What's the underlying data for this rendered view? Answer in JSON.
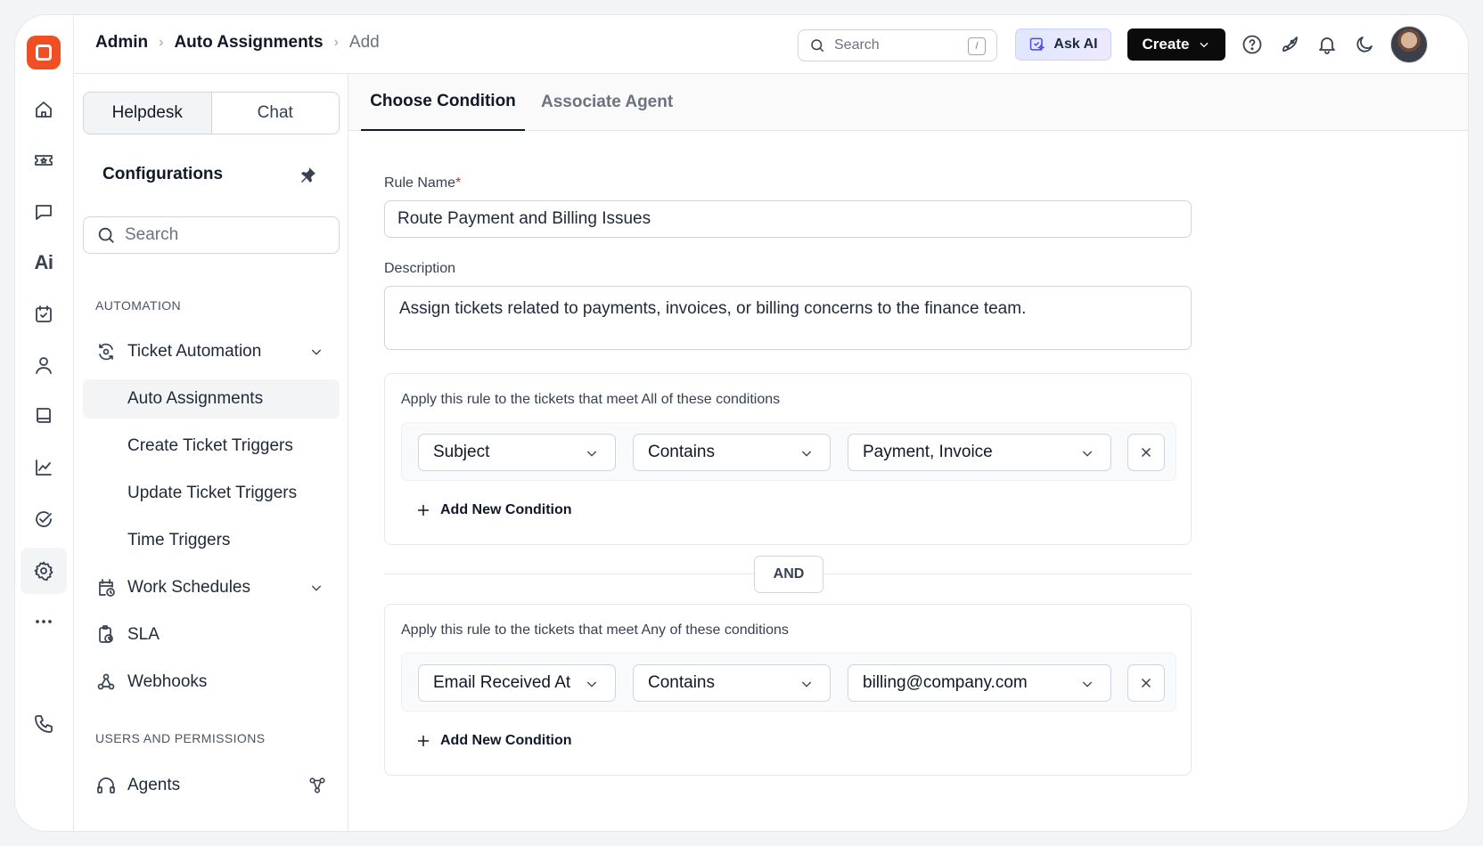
{
  "header": {
    "breadcrumb": [
      "Admin",
      "Auto Assignments",
      "Add"
    ],
    "search_placeholder": "Search",
    "search_shortcut": "/",
    "ask_ai_label": "Ask AI",
    "create_label": "Create"
  },
  "rail": {
    "items": [
      "home-icon",
      "ticket-icon",
      "chat-icon",
      "ai-icon",
      "calendar-check-icon",
      "user-icon",
      "book-icon",
      "chart-icon",
      "check-circle-icon",
      "settings-icon",
      "more-icon",
      "phone-icon"
    ],
    "ai_text": "Ai",
    "active": "settings-icon"
  },
  "config": {
    "segments": [
      "Helpdesk",
      "Chat"
    ],
    "active_segment": "Helpdesk",
    "title": "Configurations",
    "search_placeholder": "Search",
    "section_automation": "AUTOMATION",
    "items": [
      {
        "label": "Ticket Automation",
        "icon": "automation-icon",
        "expandable": true
      },
      {
        "label": "Auto Assignments",
        "active": true
      },
      {
        "label": "Create Ticket Triggers"
      },
      {
        "label": "Update Ticket Triggers"
      },
      {
        "label": "Time Triggers"
      },
      {
        "label": "Work Schedules",
        "icon": "calendar-clock-icon",
        "expandable": true
      },
      {
        "label": "SLA",
        "icon": "sla-icon"
      },
      {
        "label": "Webhooks",
        "icon": "webhook-icon"
      }
    ],
    "section_users": "USERS AND PERMISSIONS",
    "agents_label": "Agents"
  },
  "main": {
    "tabs": [
      "Choose Condition",
      "Associate Agent"
    ],
    "active_tab": "Choose Condition",
    "rule_name_label": "Rule Name",
    "required_mark": "*",
    "rule_name_value": "Route Payment and Billing Issues",
    "description_label": "Description",
    "description_value": "Assign tickets related to payments, invoices, or billing concerns to the finance team.",
    "all_group": {
      "title": "Apply this rule to the tickets that meet All of these conditions",
      "field": "Subject",
      "operator": "Contains",
      "value": "Payment, Invoice",
      "add_label": "Add New Condition"
    },
    "and_label": "AND",
    "any_group": {
      "title": "Apply this rule to the tickets that meet Any of these conditions",
      "field": "Email Received At",
      "operator": "Contains",
      "value": "billing@company.com",
      "add_label": "Add New Condition"
    }
  },
  "colors": {
    "brand": "#f04e23",
    "primary_button": "#0b0b0b",
    "required": "#dc2626"
  }
}
